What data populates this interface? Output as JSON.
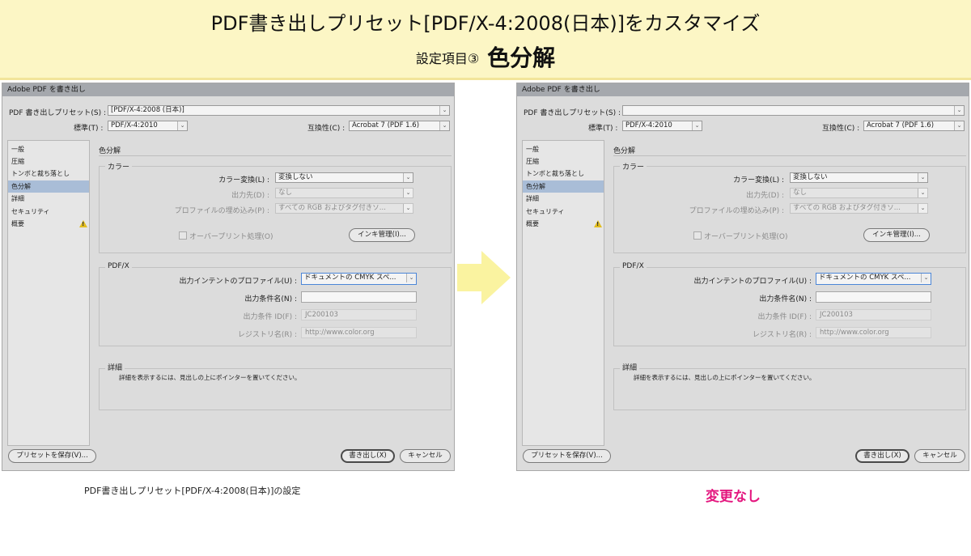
{
  "banner": {
    "title": "PDF書き出しプリセット[PDF/X-4:2008(日本)]をカスタマイズ",
    "subtitle": "設定項目③",
    "subtitle_big": "色分解"
  },
  "dialogs": {
    "left": {
      "window_title": "Adobe PDF を書き出し",
      "preset_label": "PDF 書き出しプリセット(S) :",
      "preset_value": "[PDF/X-4:2008 (日本)]",
      "standard_label": "標準(T) :",
      "standard_value": "PDF/X-4:2010",
      "compat_label": "互換性(C) :",
      "compat_value": "Acrobat 7 (PDF 1.6)",
      "sidebar": [
        "一般",
        "圧縮",
        "トンボと裁ち落とし",
        "色分解",
        "詳細",
        "セキュリティ",
        "概要"
      ],
      "section_title": "色分解",
      "color_group": "カラー",
      "color_conv_label": "カラー変換(L) :",
      "color_conv_value": "変換しない",
      "dest_label": "出力先(D) :",
      "dest_value": "なし",
      "profile_label": "プロファイルの埋め込み(P) :",
      "profile_value": "すべての RGB およびタグ付きソ...",
      "overprint_label": "オーバープリント処理(O)",
      "ink_button": "インキ管理(I)...",
      "pdfx_group": "PDF/X",
      "intent_label": "出力インテントのプロファイル(U) :",
      "intent_value": "ドキュメントの CMYK スペ...",
      "cond_name_label": "出力条件名(N) :",
      "cond_name_value": "",
      "cond_id_label": "出力条件 ID(F) :",
      "cond_id_value": "JC200103",
      "registry_label": "レジストリ名(R) :",
      "registry_value": "http://www.color.org",
      "details_group": "詳細",
      "details_text": "詳細を表示するには、見出しの上にポインターを置いてください。",
      "save_preset_button": "プリセットを保存(V)...",
      "export_button": "書き出し(X)",
      "cancel_button": "キャンセル"
    },
    "right": {
      "window_title": "Adobe PDF を書き出し",
      "preset_label": "PDF 書き出しプリセット(S) :",
      "preset_value": "",
      "standard_label": "標準(T) :",
      "standard_value": "PDF/X-4:2010",
      "compat_label": "互換性(C) :",
      "compat_value": "Acrobat 7 (PDF 1.6)",
      "sidebar": [
        "一般",
        "圧縮",
        "トンボと裁ち落とし",
        "色分解",
        "詳細",
        "セキュリティ",
        "概要"
      ],
      "section_title": "色分解",
      "color_group": "カラー",
      "color_conv_label": "カラー変換(L) :",
      "color_conv_value": "変換しない",
      "dest_label": "出力先(D) :",
      "dest_value": "なし",
      "profile_label": "プロファイルの埋め込み(P) :",
      "profile_value": "すべての RGB およびタグ付きソ...",
      "overprint_label": "オーバープリント処理(O)",
      "ink_button": "インキ管理(I)...",
      "pdfx_group": "PDF/X",
      "intent_label": "出力インテントのプロファイル(U) :",
      "intent_value": "ドキュメントの CMYK スペ...",
      "cond_name_label": "出力条件名(N) :",
      "cond_name_value": "",
      "cond_id_label": "出力条件 ID(F) :",
      "cond_id_value": "JC200103",
      "registry_label": "レジストリ名(R) :",
      "registry_value": "http://www.color.org",
      "details_group": "詳細",
      "details_text": "詳細を表示するには、見出しの上にポインターを置いてください。",
      "save_preset_button": "プリセットを保存(V)...",
      "export_button": "書き出し(X)",
      "cancel_button": "キャンセル"
    }
  },
  "captions": {
    "left": "PDF書き出しプリセット[PDF/X-4:2008(日本)]の設定",
    "right": "変更なし"
  },
  "colors": {
    "banner_bg": "#fcf6c5",
    "arrow": "#faf3a0",
    "accent_pink": "#e4177f",
    "selection": "#a9bdd7"
  },
  "icons": {
    "arrow": "right-arrow-icon",
    "warning": "warning-icon",
    "dropdown": "chevron-down-icon"
  }
}
